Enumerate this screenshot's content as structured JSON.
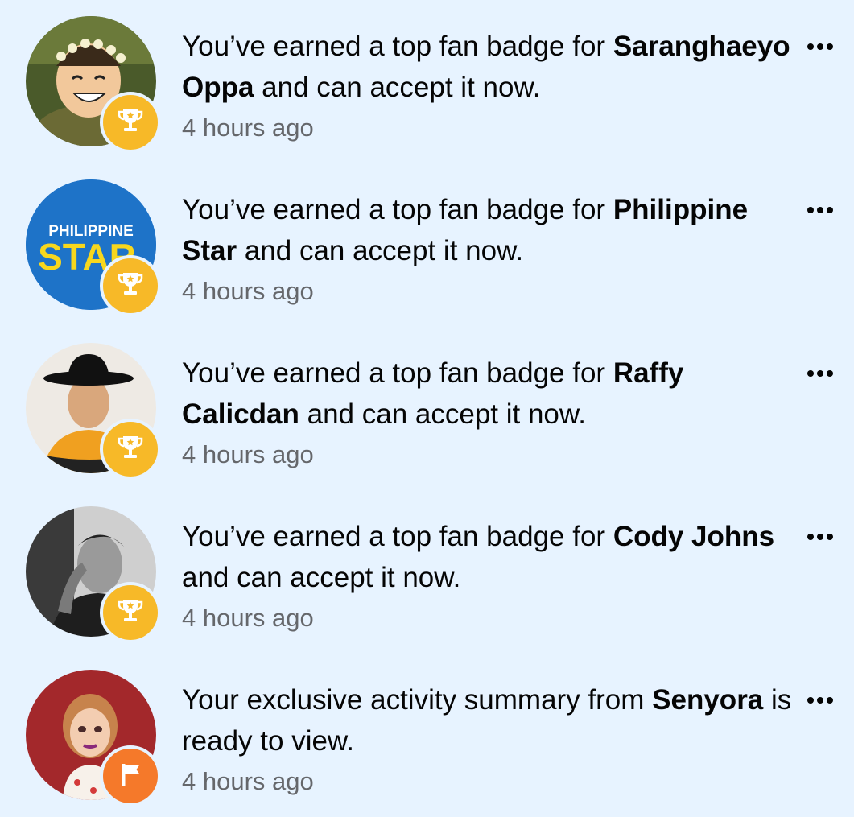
{
  "colors": {
    "background": "#e7f3ff",
    "badge_gold": "#f7b928",
    "badge_orange": "#f5792a",
    "secondary_text": "#65676b"
  },
  "notifications": [
    {
      "prefix": "You’ve earned a top fan badge for ",
      "name": "Saranghaeyo Oppa",
      "suffix": " and can accept it now.",
      "time": "4 hours ago",
      "badge_icon": "trophy-icon",
      "avatar": "cartoon-soldier-avatar"
    },
    {
      "prefix": "You’ve earned a top fan badge for ",
      "name": "Philippine Star",
      "suffix": " and can accept it now.",
      "time": "4 hours ago",
      "badge_icon": "trophy-icon",
      "avatar": "philippine-star-logo",
      "logo_text_top": "PHILIPPINE",
      "logo_text_bottom": "STAR"
    },
    {
      "prefix": "You’ve earned a top fan badge for ",
      "name": "Raffy Calicdan",
      "suffix": " and can accept it now.",
      "time": "4 hours ago",
      "badge_icon": "trophy-icon",
      "avatar": "man-in-hat-avatar"
    },
    {
      "prefix": "You’ve earned a top fan badge for ",
      "name": "Cody Johns",
      "suffix": " and can accept it now.",
      "time": "4 hours ago",
      "badge_icon": "trophy-icon",
      "avatar": "monochrome-portrait-avatar"
    },
    {
      "prefix": "Your exclusive activity summary from ",
      "name": "Senyora",
      "suffix": " is ready to view.",
      "time": "4 hours ago",
      "badge_icon": "flag-icon",
      "avatar": "cartoon-woman-avatar"
    }
  ]
}
